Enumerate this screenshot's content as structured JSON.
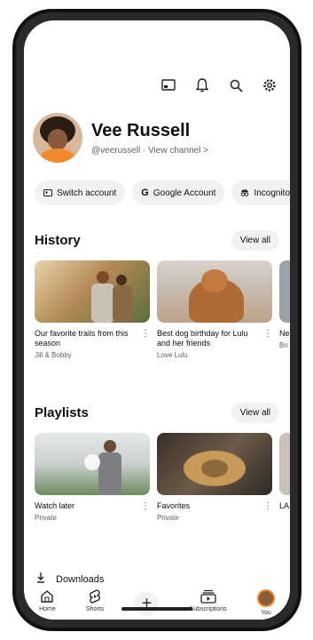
{
  "topbar": {
    "icons": [
      "cast-icon",
      "bell-icon",
      "search-icon",
      "gear-icon"
    ]
  },
  "profile": {
    "name": "Vee Russell",
    "handle": "@veerussell",
    "view_channel": "View channel >"
  },
  "chips": [
    {
      "label": "Switch account"
    },
    {
      "label": "Google Account"
    },
    {
      "label": "Incognito"
    }
  ],
  "history": {
    "title": "History",
    "view_all": "View all",
    "items": [
      {
        "title": "Our favorite trails from this season",
        "meta": "Jill & Bobby"
      },
      {
        "title": "Best dog birthday for Lulu and her friends",
        "meta": "Love Lulu"
      },
      {
        "title": "Ne",
        "meta": "Bri"
      }
    ]
  },
  "playlists": {
    "title": "Playlists",
    "view_all": "View all",
    "items": [
      {
        "title": "Watch later",
        "meta": "Private"
      },
      {
        "title": "Favorites",
        "meta": "Private"
      },
      {
        "title": "LA",
        "meta": ""
      }
    ]
  },
  "downloads": {
    "label": "Downloads"
  },
  "nav": {
    "home": "Home",
    "shorts": "Shorts",
    "subscriptions": "Subscriptions",
    "you": "You"
  },
  "colors": {
    "accent": "#f08a2a",
    "chip_bg": "#f2f2f2"
  }
}
